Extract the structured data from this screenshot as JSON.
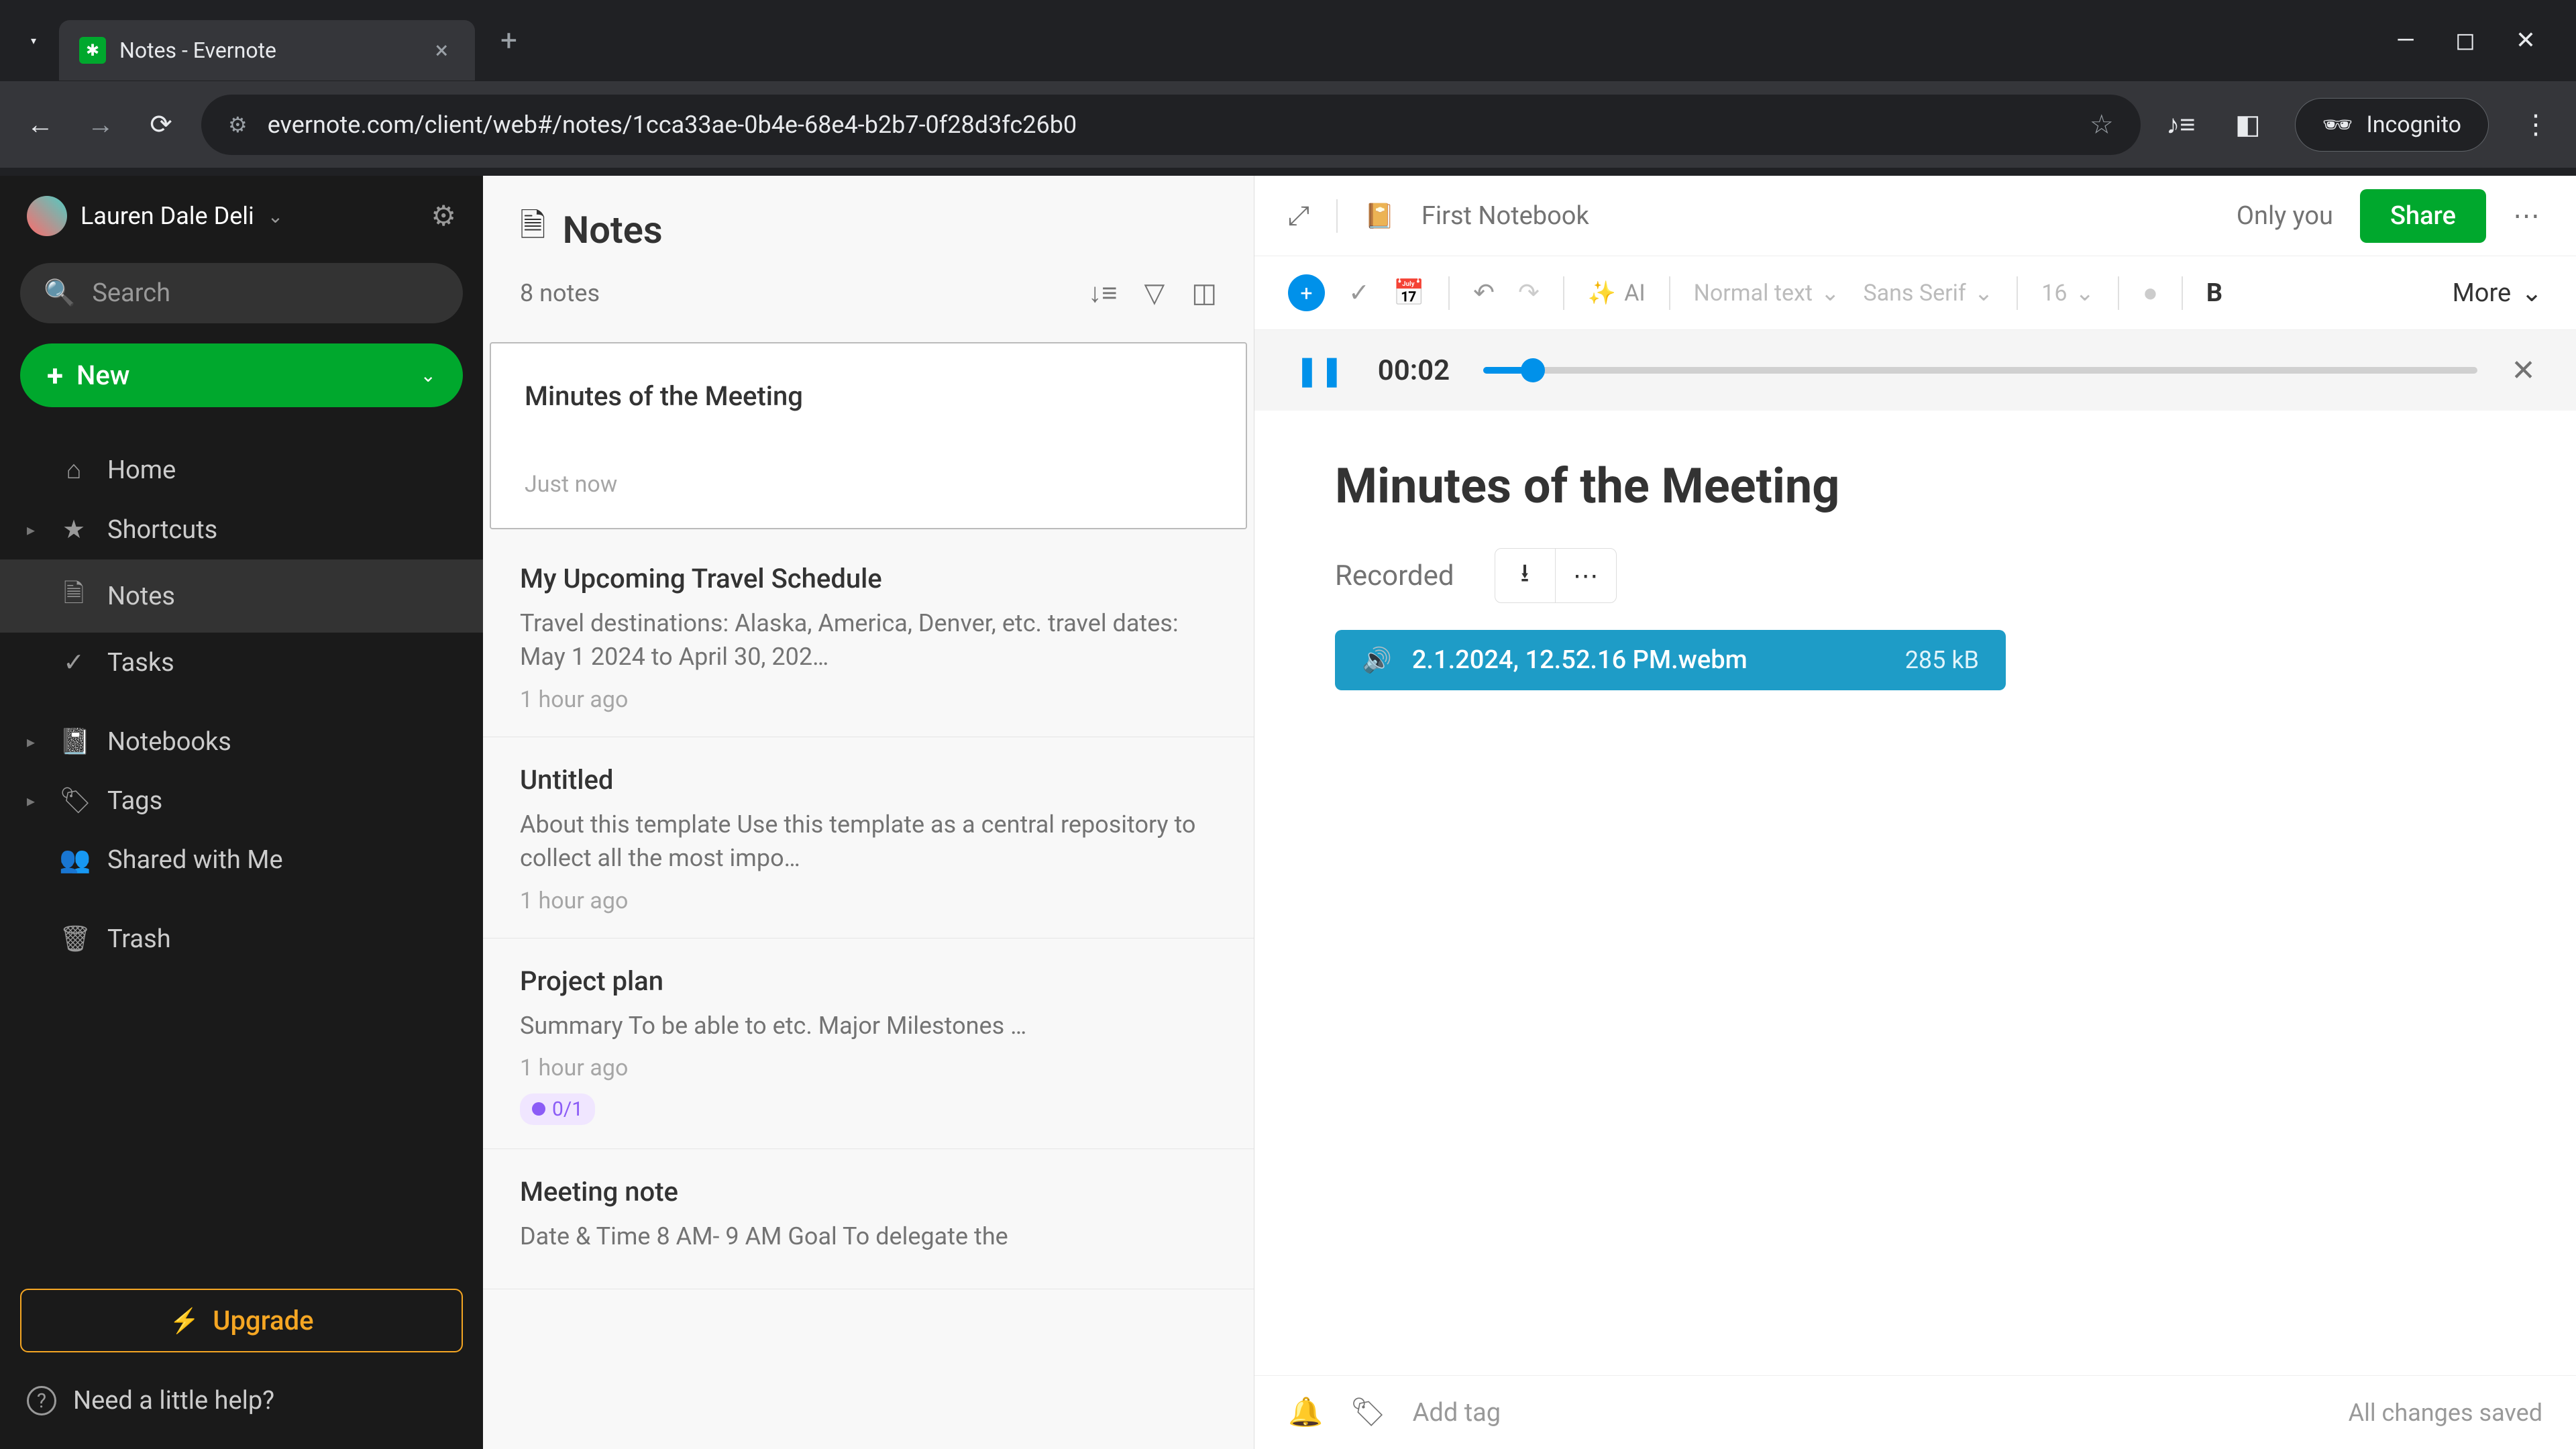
{
  "browser": {
    "tab_title": "Notes - Evernote",
    "url": "evernote.com/client/web#/notes/1cca33ae-0b4e-68e4-b2b7-0f28d3fc26b0",
    "incognito": "Incognito"
  },
  "sidebar": {
    "username": "Lauren Dale Deli",
    "search_placeholder": "Search",
    "new_label": "New",
    "items": [
      {
        "icon": "⌂",
        "label": "Home",
        "expandable": false
      },
      {
        "icon": "★",
        "label": "Shortcuts",
        "expandable": true
      },
      {
        "icon": "🗎",
        "label": "Notes",
        "expandable": false,
        "active": true
      },
      {
        "icon": "✓",
        "label": "Tasks",
        "expandable": false
      },
      {
        "icon": "📓",
        "label": "Notebooks",
        "expandable": true
      },
      {
        "icon": "🏷",
        "label": "Tags",
        "expandable": true
      },
      {
        "icon": "👥",
        "label": "Shared with Me",
        "expandable": false
      },
      {
        "icon": "🗑",
        "label": "Trash",
        "expandable": false
      }
    ],
    "upgrade": "Upgrade",
    "help": "Need a little help?"
  },
  "list": {
    "title": "Notes",
    "count": "8 notes",
    "notes": [
      {
        "title": "Minutes of the Meeting",
        "snippet": "",
        "time": "Just now",
        "selected": true
      },
      {
        "title": "My Upcoming Travel Schedule",
        "snippet": "Travel destinations: Alaska, America, Denver, etc. travel dates: May 1 2024 to April 30, 202…",
        "time": "1 hour ago"
      },
      {
        "title": "Untitled",
        "snippet": "About this template Use this template as a central repository to collect all the most impo…",
        "time": "1 hour ago"
      },
      {
        "title": "Project plan",
        "snippet": "Summary To be able to etc. Major Milestones …",
        "time": "1 hour ago",
        "badge": "0/1"
      },
      {
        "title": "Meeting note",
        "snippet": "Date & Time 8 AM- 9 AM Goal To delegate the",
        "time": ""
      }
    ]
  },
  "editor": {
    "notebook": "First Notebook",
    "only_you": "Only you",
    "share": "Share",
    "toolbar": {
      "ai": "AI",
      "style": "Normal text",
      "font": "Sans Serif",
      "size": "16",
      "more": "More"
    },
    "audio": {
      "time": "00:02"
    },
    "title": "Minutes of the Meeting",
    "recorded_label": "Recorded",
    "file": {
      "name": "2.1.2024, 12.52.16 PM.webm",
      "size": "285 kB"
    },
    "footer": {
      "add_tag": "Add tag",
      "status": "All changes saved"
    }
  }
}
